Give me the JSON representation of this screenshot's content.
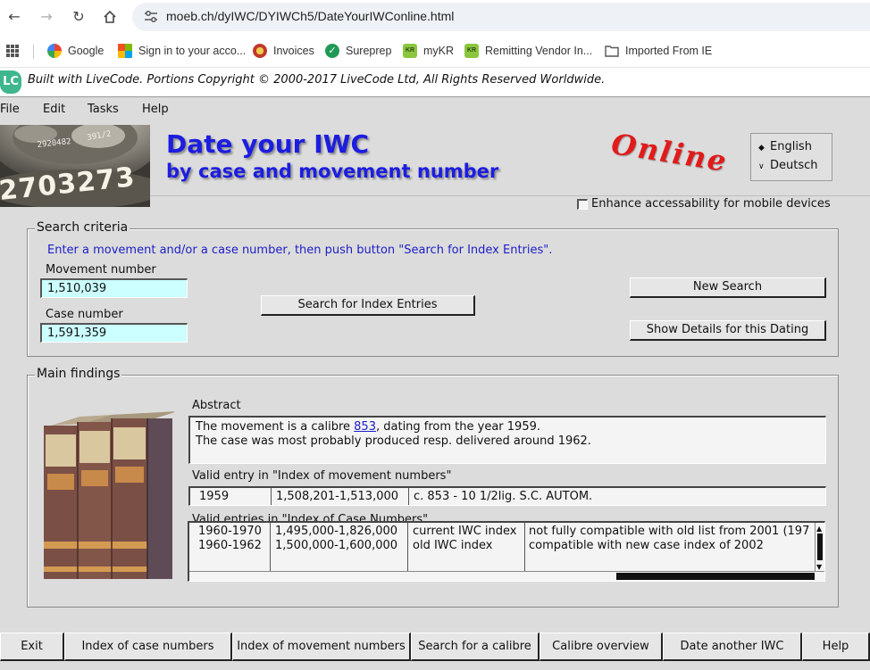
{
  "browser": {
    "url": "moeb.ch/dyIWC/DYIWCh5/DateYourIWConline.html",
    "bookmarks": [
      {
        "label": "Google",
        "color": "#4285f4"
      },
      {
        "label": "Sign in to your acco...",
        "color": "#e8a33b"
      },
      {
        "label": "Invoices",
        "color": "#d23b3b"
      },
      {
        "label": "Sureprep",
        "color": "#1f9a55"
      },
      {
        "label": "myKR",
        "color": "#8cc63f"
      },
      {
        "label": "Remitting Vendor In...",
        "color": "#8cc63f"
      },
      {
        "label": "Imported From IE",
        "color": "#555555"
      }
    ]
  },
  "banner": {
    "logo": "LC",
    "text": "Built with LiveCode. Portions Copyright © 2000-2017 LiveCode Ltd, All Rights Reserved Worldwide."
  },
  "menu": [
    "File",
    "Edit",
    "Tasks",
    "Help"
  ],
  "header": {
    "title": "Date your IWC",
    "subtitle": "by case and movement number",
    "online": "Online",
    "languages": [
      "English",
      "Deutsch"
    ],
    "selected_language": "English",
    "accessibility_label": "Enhance accessability for mobile devices"
  },
  "search": {
    "group_label": "Search criteria",
    "hint": "Enter a movement and/or a case number, then push button \"Search for Index Entries\".",
    "movement_label": "Movement number",
    "movement_value": "1,510,039",
    "case_label": "Case number",
    "case_value": "1,591,359",
    "search_button": "Search for Index Entries",
    "new_search_button": "New Search",
    "details_button": "Show Details for this Dating"
  },
  "findings": {
    "group_label": "Main findings",
    "abstract_label": "Abstract",
    "abstract_pre": "The movement is a calibre ",
    "abstract_link": "853",
    "abstract_post": ", dating from the year 1959.",
    "abstract_line2": "The case was most probably produced resp. delivered around 1962.",
    "movement_index_label": "Valid entry in \"Index of movement numbers\"",
    "movement_entry": [
      "1959",
      "1,508,201-1,513,000",
      "c. 853 - 10 1/2lig. S.C. AUTOM."
    ],
    "case_index_label": "Valid entries in \"Index of Case Numbers\"",
    "case_entries": [
      [
        "1960-1970",
        "1,495,000-1,826,000",
        "current IWC index",
        "not fully compatible with old list from 2001 (197"
      ],
      [
        "1960-1962",
        "1,500,000-1,600,000",
        "old IWC index",
        "compatible with new case index of 2002"
      ]
    ]
  },
  "toolbar": [
    "Exit",
    "Index of case numbers",
    "Index of movement numbers",
    "Search for a calibre",
    "Calibre overview",
    "Date another IWC",
    "Help"
  ]
}
